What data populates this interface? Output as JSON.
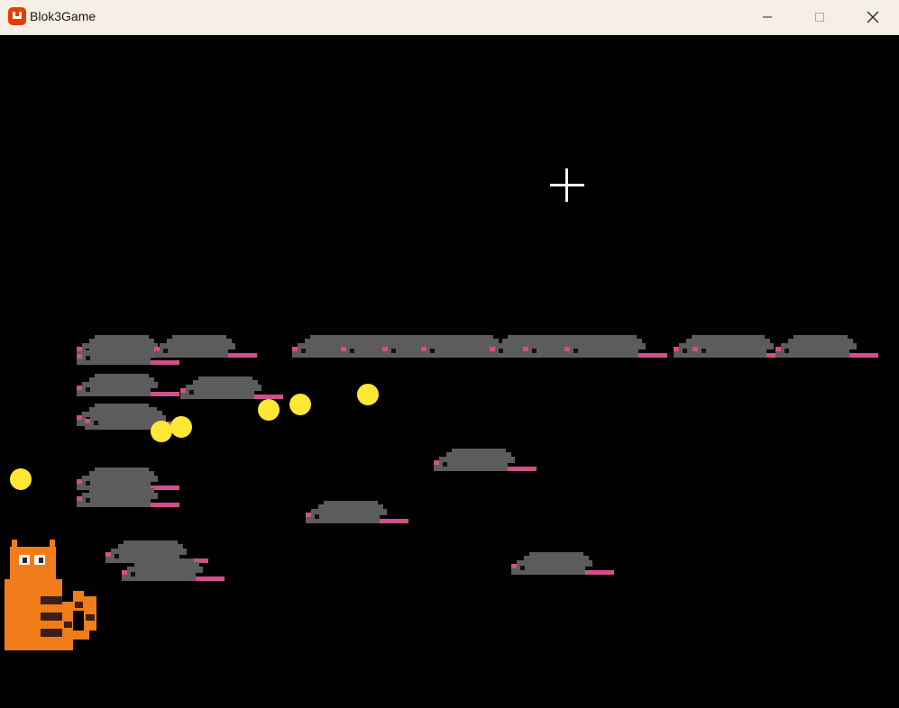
{
  "window": {
    "title": "Blok3Game",
    "icon": "monogame-logo-icon",
    "controls": [
      "minimize-icon",
      "maximize-icon",
      "close-icon"
    ]
  },
  "game": {
    "background_color": "#000000",
    "entities": {
      "player": "orange-cat",
      "crosshair": "crosshair",
      "enemies": "gray-mice",
      "pickups": "yellow-coins"
    },
    "colors": {
      "mouse_body": "#5c5c5c",
      "mouse_tail": "#d0508a",
      "mouse_eye": "#111111",
      "coin": "#ffe733",
      "cat_orange": "#f07c1a",
      "cat_stripe": "#3a1f1a",
      "crosshair": "#ffffff"
    }
  }
}
